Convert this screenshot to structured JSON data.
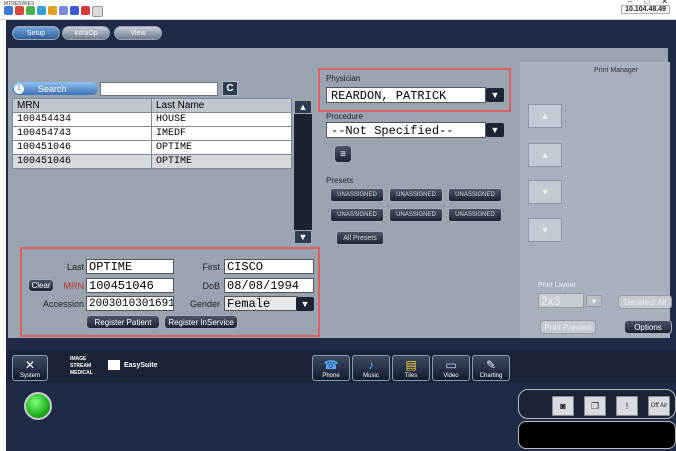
{
  "titlebar": {
    "app_name": "MTRESWIES",
    "ip": "10.104.48.49",
    "minimize": "–",
    "maximize": "□",
    "close": "✕"
  },
  "tabs": [
    {
      "label": "Setup"
    },
    {
      "label": "IntraOp"
    },
    {
      "label": "View"
    }
  ],
  "search": {
    "badge": "1",
    "label": "Search",
    "value": "",
    "clear_label": "C"
  },
  "patient_table": {
    "columns": [
      "MRN",
      "Last Name"
    ],
    "rows": [
      {
        "mrn": "100454434",
        "last": "HOUSE"
      },
      {
        "mrn": "100454743",
        "last": "IMEDF"
      },
      {
        "mrn": "100451046",
        "last": "OPTIME"
      },
      {
        "mrn": "100451046",
        "last": "OPTIME"
      }
    ]
  },
  "registration": {
    "last_label": "Last",
    "last_value": "OPTIME",
    "first_label": "First",
    "first_value": "CISCO",
    "clear_label": "Clear",
    "mrn_label": "MRN",
    "mrn_value": "100451046",
    "dob_label": "DoB",
    "dob_value": "08/08/1994",
    "accession_label": "Accession",
    "accession_value": "2003010301691",
    "gender_label": "Gender",
    "gender_value": "Female",
    "register_patient": "Register Patient",
    "register_inservice": "Register InService"
  },
  "physician": {
    "label": "Physician",
    "value": "REARDON, PATRICK"
  },
  "procedure": {
    "label": "Procedure",
    "value": "--Not Specified--"
  },
  "presets": {
    "label": "Presets",
    "items": [
      "UNASSIGNED",
      "UNASSIGNED",
      "UNASSIGNED",
      "UNASSIGNED",
      "UNASSIGNED",
      "UNASSIGNED"
    ],
    "all_label": "All Presets"
  },
  "print_manager": {
    "title": "Print Manager",
    "layout_label": "Print Layout",
    "layout_value": "2x3",
    "deselect_all": "Deselect All",
    "print_preview": "Print Preview",
    "options": "Options"
  },
  "bottom": {
    "system": "System",
    "logo_line1": "IMAGE",
    "logo_line2": "STREAM",
    "logo_line3": "MEDICAL",
    "easysuite": "EasySuite",
    "buttons": [
      {
        "label": "Phone"
      },
      {
        "label": "Music"
      },
      {
        "label": "Tiles"
      },
      {
        "label": "Video"
      },
      {
        "label": "Charting"
      }
    ],
    "off_air": "Off Air"
  },
  "colors": {
    "app_bg": "#1f2b46",
    "panel": "#9aa4b1",
    "highlight": "#e06060",
    "status_on": "#1fb01f"
  }
}
